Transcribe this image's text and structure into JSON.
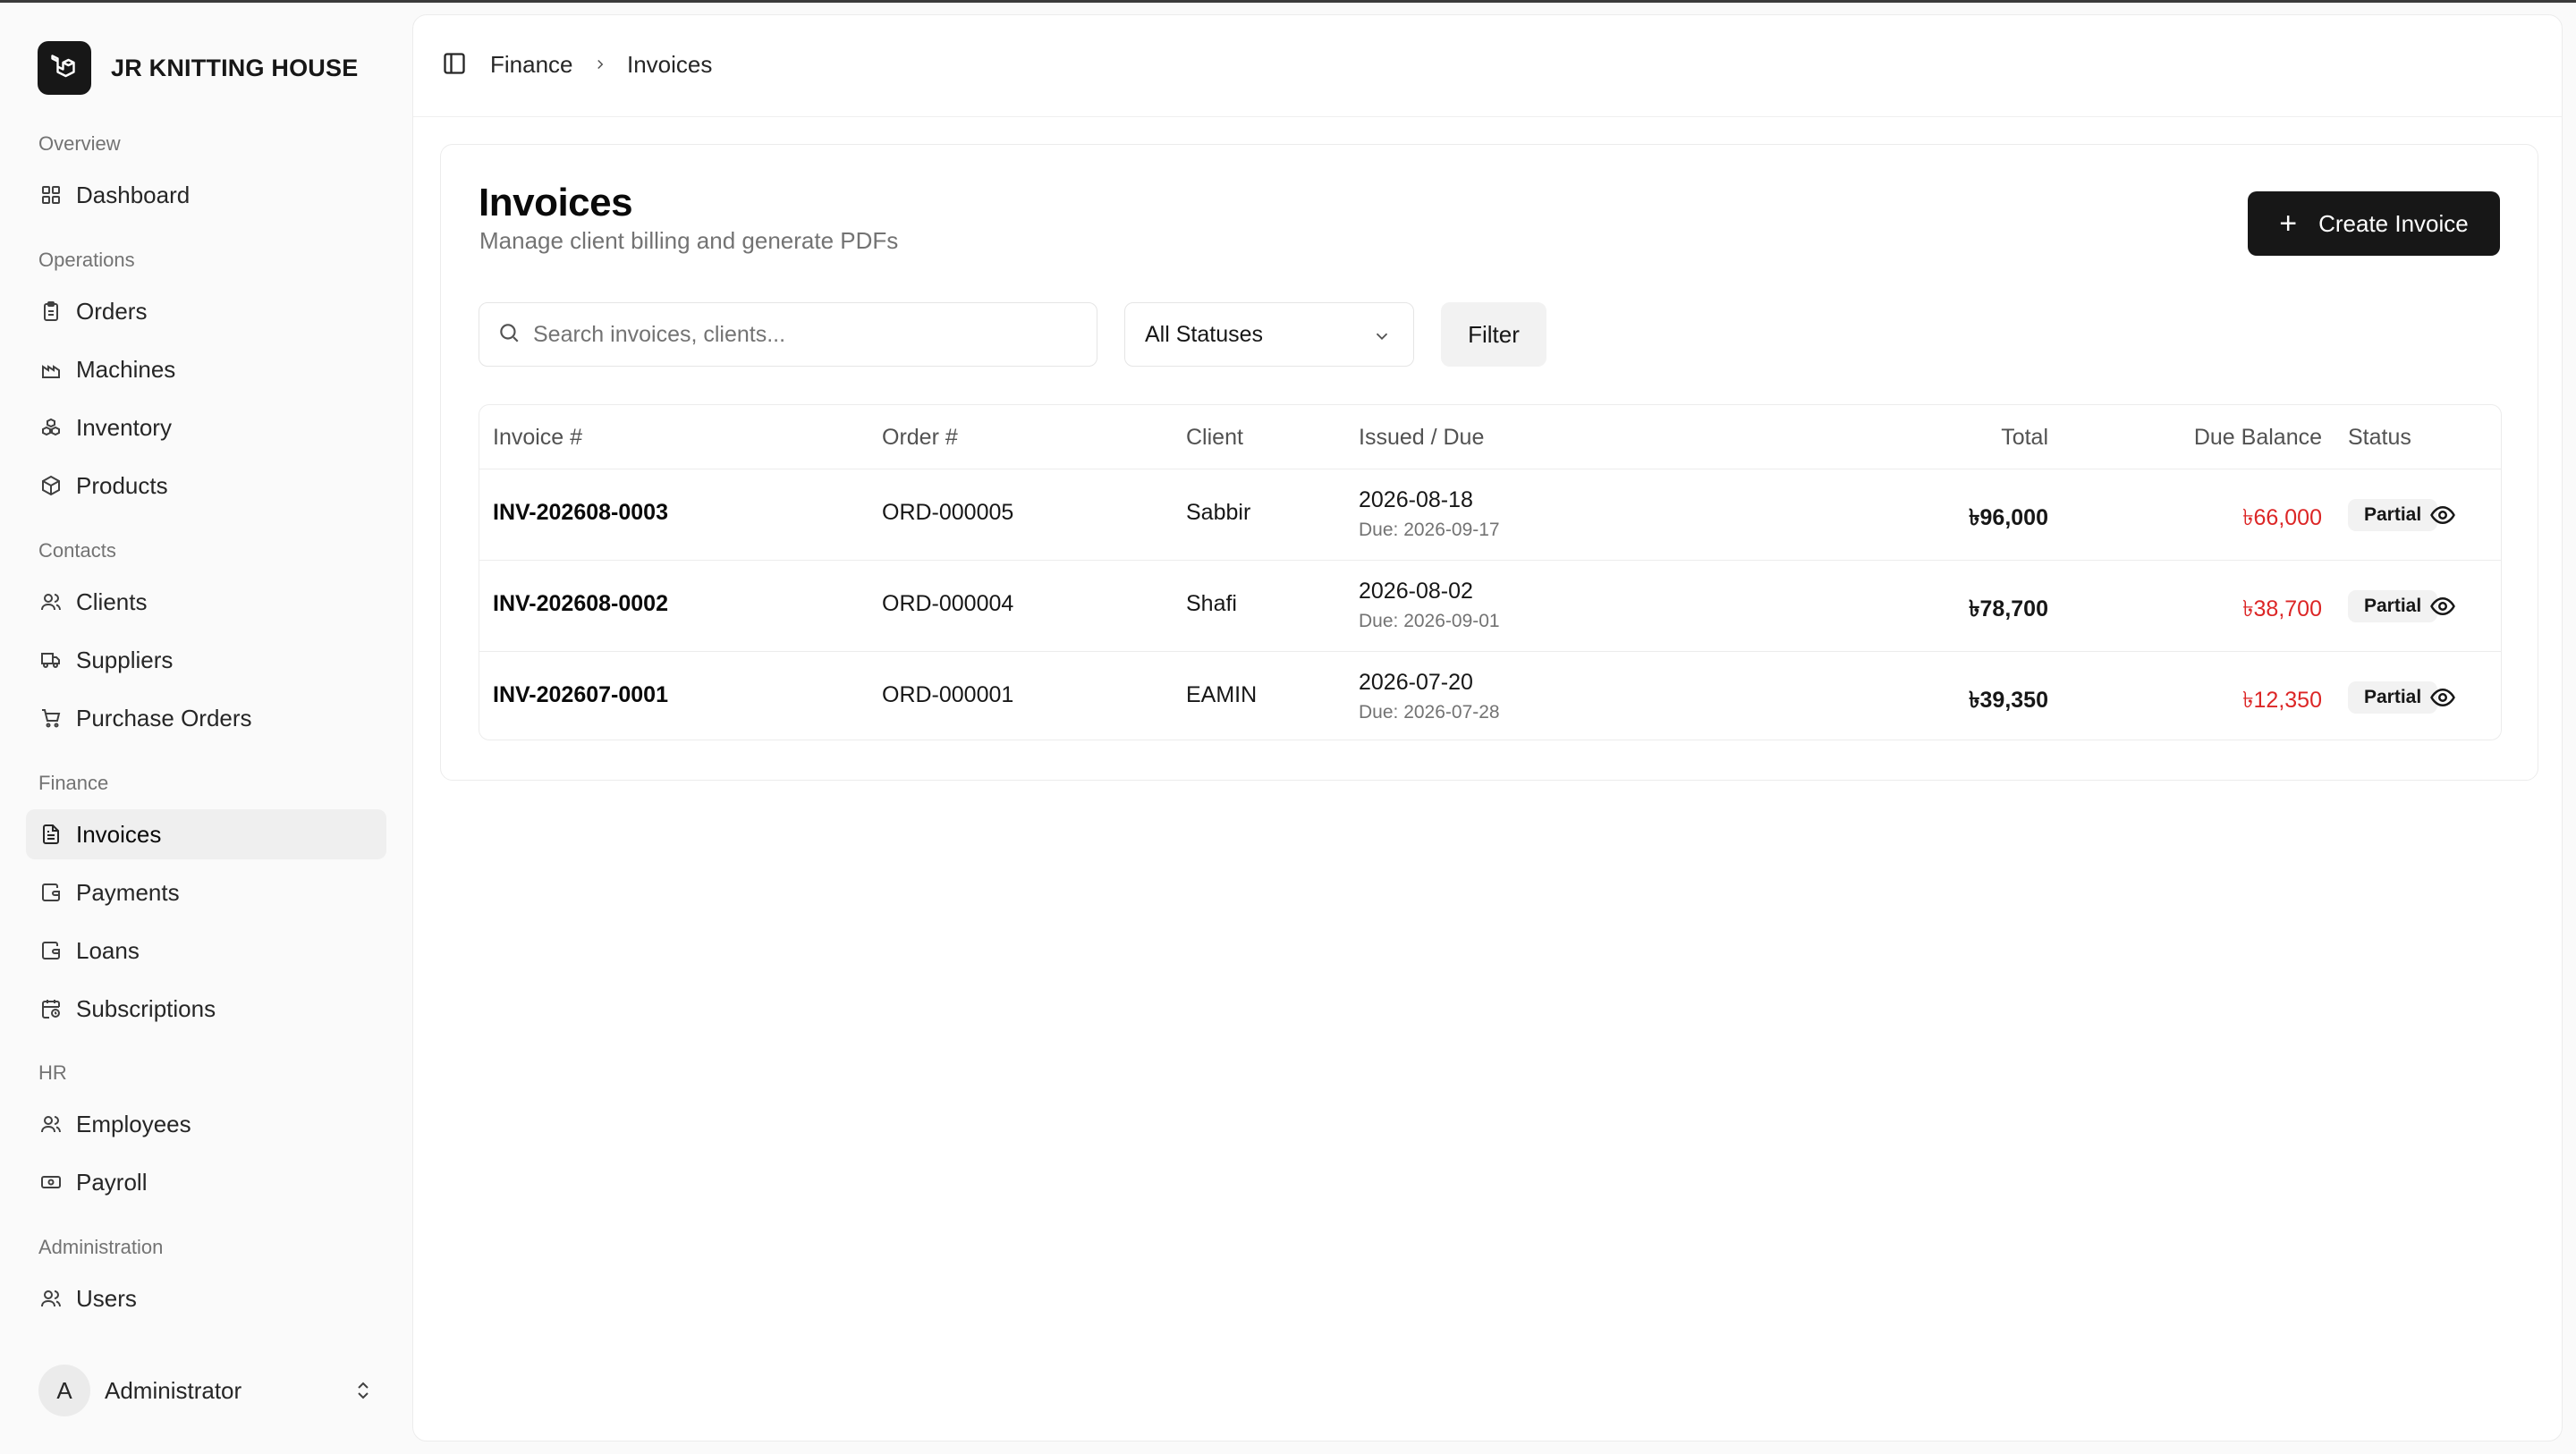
{
  "brand": {
    "name": "JR KNITTING HOUSE"
  },
  "sidebar": {
    "groups": [
      {
        "label": "Overview"
      },
      {
        "label": "Operations"
      },
      {
        "label": "Contacts"
      },
      {
        "label": "Finance"
      },
      {
        "label": "HR"
      },
      {
        "label": "Administration"
      }
    ],
    "items": [
      {
        "label": "Dashboard",
        "icon": "dashboard-grid-icon"
      },
      {
        "label": "Orders",
        "icon": "clipboard-icon"
      },
      {
        "label": "Machines",
        "icon": "factory-icon"
      },
      {
        "label": "Inventory",
        "icon": "boxes-icon"
      },
      {
        "label": "Products",
        "icon": "package-icon"
      },
      {
        "label": "Clients",
        "icon": "users-icon"
      },
      {
        "label": "Suppliers",
        "icon": "truck-icon"
      },
      {
        "label": "Purchase Orders",
        "icon": "cart-icon"
      },
      {
        "label": "Invoices",
        "icon": "file-text-icon",
        "active": true
      },
      {
        "label": "Payments",
        "icon": "wallet-icon"
      },
      {
        "label": "Loans",
        "icon": "wallet-icon"
      },
      {
        "label": "Subscriptions",
        "icon": "calendar-clock-icon"
      },
      {
        "label": "Employees",
        "icon": "users-icon"
      },
      {
        "label": "Payroll",
        "icon": "banknote-icon"
      },
      {
        "label": "Users",
        "icon": "users-icon"
      }
    ],
    "user": {
      "initial": "A",
      "name": "Administrator"
    }
  },
  "header": {
    "breadcrumb": [
      "Finance",
      "Invoices"
    ]
  },
  "page": {
    "title": "Invoices",
    "subtitle": "Manage client billing and generate PDFs",
    "create_label": "Create Invoice",
    "search_placeholder": "Search invoices, clients...",
    "status_select": "All Statuses",
    "filter_label": "Filter"
  },
  "table": {
    "columns": [
      "Invoice #",
      "Order #",
      "Client",
      "Issued / Due",
      "Total",
      "Due Balance",
      "Status"
    ],
    "rows": [
      {
        "invoice": "INV-202608-0003",
        "order": "ORD-000005",
        "client": "Sabbir",
        "issued": "2026-08-18",
        "due": "Due: 2026-09-17",
        "total": "৳96,000",
        "balance": "৳66,000",
        "status": "Partial"
      },
      {
        "invoice": "INV-202608-0002",
        "order": "ORD-000004",
        "client": "Shafi",
        "issued": "2026-08-02",
        "due": "Due: 2026-09-01",
        "total": "৳78,700",
        "balance": "৳38,700",
        "status": "Partial"
      },
      {
        "invoice": "INV-202607-0001",
        "order": "ORD-000001",
        "client": "EAMIN",
        "issued": "2026-07-20",
        "due": "Due: 2026-07-28",
        "total": "৳39,350",
        "balance": "৳12,350",
        "status": "Partial"
      }
    ]
  },
  "colors": {
    "accent": "#171717",
    "danger": "#dc2626",
    "muted": "#737373"
  }
}
